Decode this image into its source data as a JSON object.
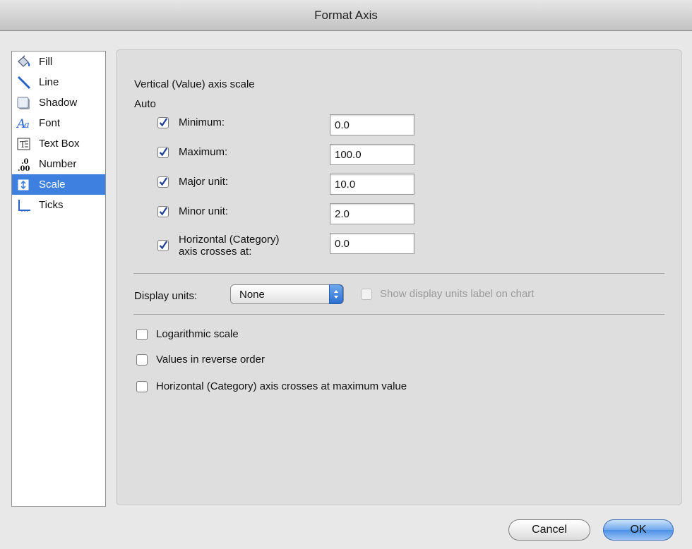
{
  "window": {
    "title": "Format Axis"
  },
  "sidebar": {
    "items": [
      {
        "label": "Fill",
        "icon": "paint-bucket-icon"
      },
      {
        "label": "Line",
        "icon": "diagonal-line-icon"
      },
      {
        "label": "Shadow",
        "icon": "shadow-square-icon"
      },
      {
        "label": "Font",
        "icon": "font-aa-icon"
      },
      {
        "label": "Text Box",
        "icon": "text-box-icon"
      },
      {
        "label": "Number",
        "icon": "number-format-icon"
      },
      {
        "label": "Scale",
        "icon": "scale-icon",
        "selected": true
      },
      {
        "label": "Ticks",
        "icon": "ticks-icon"
      }
    ]
  },
  "scale": {
    "section_title": "Vertical (Value) axis scale",
    "auto_label": "Auto",
    "rows": [
      {
        "label": "Minimum:",
        "checked": true,
        "value": "0.0"
      },
      {
        "label": "Maximum:",
        "checked": true,
        "value": "100.0"
      },
      {
        "label": "Major unit:",
        "checked": true,
        "value": "10.0"
      },
      {
        "label": "Minor unit:",
        "checked": true,
        "value": "2.0"
      },
      {
        "label_line1": "Horizontal (Category)",
        "label_line2": "axis crosses at:",
        "checked": true,
        "value": "0.0"
      }
    ],
    "display_units_label": "Display units:",
    "display_units_value": "None",
    "show_units_label": "Show display units label on chart",
    "options": [
      {
        "label": "Logarithmic scale",
        "checked": false
      },
      {
        "label": "Values in reverse order",
        "checked": false
      },
      {
        "label": "Horizontal (Category) axis crosses at maximum value",
        "checked": false
      }
    ]
  },
  "buttons": {
    "cancel": "Cancel",
    "ok": "OK"
  },
  "colors": {
    "selection": "#3d80df",
    "panel": "#dedede"
  }
}
